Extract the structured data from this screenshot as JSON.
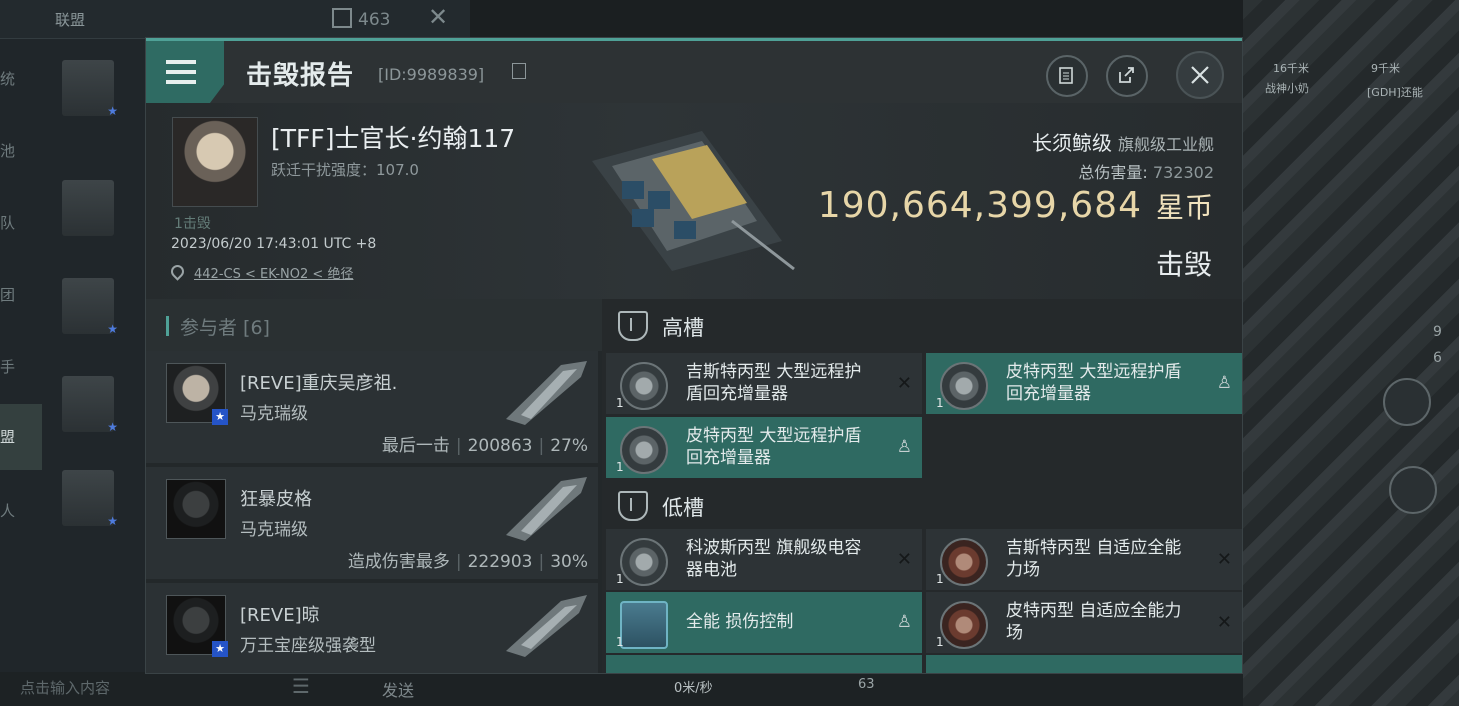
{
  "background": {
    "alliance_tab": "联盟",
    "member_count": "463",
    "side_tabs": [
      "统",
      "池",
      "队",
      "团",
      "手",
      "盟",
      "人"
    ],
    "active_side_tab": "盟",
    "chat_placeholder": "点击输入内容",
    "send_label": "发送",
    "speed": "0米/秒",
    "speed_num": "63",
    "right_chips": [
      "16千米",
      "战神小奶",
      "9千米",
      "[GDH]还能"
    ],
    "right_counts": [
      "9",
      "6"
    ]
  },
  "dialog": {
    "title": "击毁报告",
    "report_id": "[ID:9989839]",
    "victim": {
      "name": "[TFF]士官长·约翰117",
      "warp": "跃迁干扰强度：107.0",
      "kills": "1击毁",
      "datetime": "2023/06/20 17:43:01 UTC +8",
      "location": "442-CS < EK-NO2 < 绝径"
    },
    "ship": {
      "name": "长须鲸级",
      "class": "旗舰级工业舰",
      "total_damage_label": "总伤害量:",
      "total_damage": "732302",
      "value": "190,664,399,684",
      "currency": "星币",
      "status": "击毁"
    },
    "participants": {
      "header": "参与者 [6]",
      "rows": [
        {
          "name": "[REVE]重庆吴彦祖.",
          "ship": "马克瑞级",
          "note": "最后一击",
          "damage": "200863",
          "pct": "27%",
          "badge": true
        },
        {
          "name": "狂暴皮格",
          "ship": "马克瑞级",
          "note": "造成伤害最多",
          "damage": "222903",
          "pct": "30%",
          "badge": false
        },
        {
          "name": "[REVE]晾",
          "ship": "万王宝座级强袭型",
          "note": "",
          "damage": "",
          "pct": "",
          "badge": true
        }
      ]
    },
    "high_slots": {
      "label": "高槽",
      "modules": [
        {
          "name": "吉斯特丙型 大型远程护盾回充增量器",
          "qty": "1"
        },
        {
          "name": "皮特丙型 大型远程护盾回充增量器",
          "qty": "1"
        },
        {
          "name": "皮特丙型 大型远程护盾回充增量器",
          "qty": "1"
        }
      ]
    },
    "low_slots": {
      "label": "低槽",
      "modules": [
        {
          "name": "科波斯丙型 旗舰级电容器电池",
          "qty": "1"
        },
        {
          "name": "吉斯特丙型 自适应全能力场",
          "qty": "1"
        },
        {
          "name": "全能 损伤控制",
          "qty": "1"
        },
        {
          "name": "皮特丙型 自适应全能力场",
          "qty": "1"
        }
      ]
    }
  }
}
